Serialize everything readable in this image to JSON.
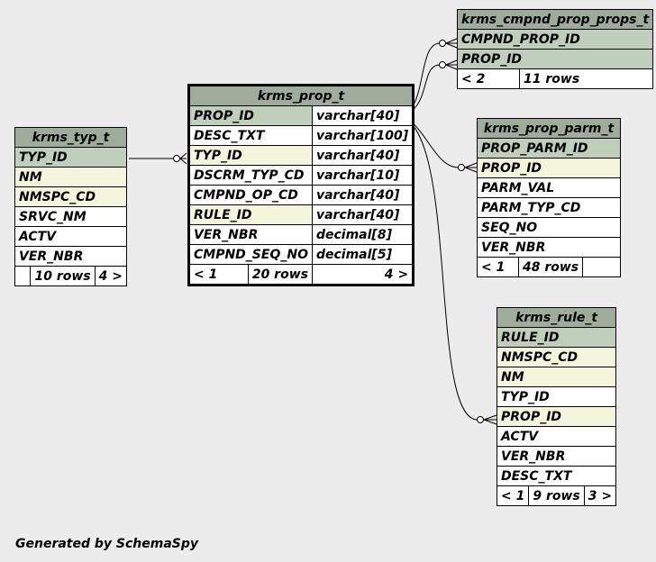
{
  "tables": {
    "cmpnd": {
      "name": "krms_cmpnd_prop_props_t",
      "columns": [
        "CMPND_PROP_ID",
        "PROP_ID"
      ],
      "footer": {
        "parents": "< 2",
        "rows": "11 rows"
      }
    },
    "typ": {
      "name": "krms_typ_t",
      "columns": [
        "TYP_ID",
        "NM",
        "NMSPC_CD",
        "SRVC_NM",
        "ACTV",
        "VER_NBR"
      ],
      "footer": {
        "rows": "10 rows",
        "children": "4 >"
      }
    },
    "prop": {
      "name": "krms_prop_t",
      "columns": [
        {
          "name": "PROP_ID",
          "type": "varchar[40]"
        },
        {
          "name": "DESC_TXT",
          "type": "varchar[100]"
        },
        {
          "name": "TYP_ID",
          "type": "varchar[40]"
        },
        {
          "name": "DSCRM_TYP_CD",
          "type": "varchar[10]"
        },
        {
          "name": "CMPND_OP_CD",
          "type": "varchar[40]"
        },
        {
          "name": "RULE_ID",
          "type": "varchar[40]"
        },
        {
          "name": "VER_NBR",
          "type": "decimal[8]"
        },
        {
          "name": "CMPND_SEQ_NO",
          "type": "decimal[5]"
        }
      ],
      "footer": {
        "parents": "< 1",
        "rows": "20 rows",
        "children": "4 >"
      }
    },
    "parm": {
      "name": "krms_prop_parm_t",
      "columns": [
        "PROP_PARM_ID",
        "PROP_ID",
        "PARM_VAL",
        "PARM_TYP_CD",
        "SEQ_NO",
        "VER_NBR"
      ],
      "footer": {
        "parents": "< 1",
        "rows": "48 rows"
      }
    },
    "rule": {
      "name": "krms_rule_t",
      "columns": [
        "RULE_ID",
        "NMSPC_CD",
        "NM",
        "TYP_ID",
        "PROP_ID",
        "ACTV",
        "VER_NBR",
        "DESC_TXT"
      ],
      "footer": {
        "parents": "< 1",
        "rows": "9 rows",
        "children": "3 >"
      }
    }
  },
  "footer_text": "Generated by SchemaSpy",
  "colors": {
    "background": "#ececec",
    "header": "#9fab9b",
    "primary_key": "#bfcfbb",
    "foreign_key": "#f3f6dd"
  }
}
